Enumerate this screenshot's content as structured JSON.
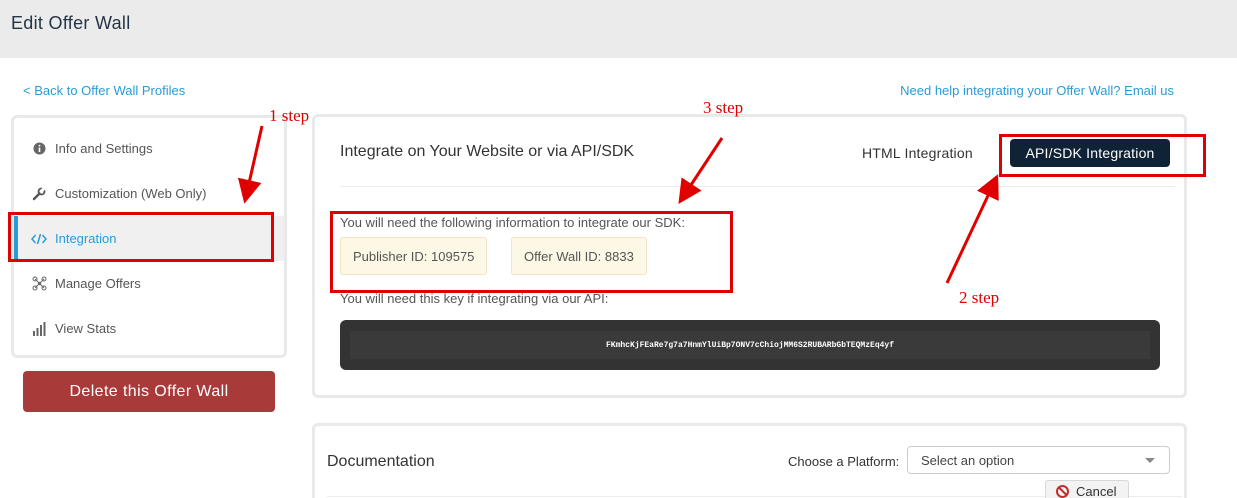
{
  "header": {
    "title": "Edit Offer Wall"
  },
  "links": {
    "back": "< Back to Offer Wall Profiles",
    "help": "Need help integrating your Offer Wall? Email us"
  },
  "sidebar": {
    "items": [
      {
        "label": "Info and Settings",
        "icon": "info-icon",
        "active": false
      },
      {
        "label": "Customization (Web Only)",
        "icon": "wrench-icon",
        "active": false
      },
      {
        "label": "Integration",
        "icon": "code-icon",
        "active": true
      },
      {
        "label": "Manage Offers",
        "icon": "network-icon",
        "active": false
      },
      {
        "label": "View Stats",
        "icon": "bar-chart-icon",
        "active": false
      }
    ],
    "delete_label": "Delete this Offer Wall"
  },
  "integration": {
    "title": "Integrate on Your Website or via API/SDK",
    "tabs": {
      "html": "HTML Integration",
      "api": "API/SDK Integration"
    },
    "sdk_text": "You will need the following information to integrate our SDK:",
    "publisher_id": "Publisher ID: 109575",
    "offer_wall_id": "Offer Wall ID: 8833",
    "api_text": "You will need this key if integrating via our API:",
    "api_key": "FKmhcKjFEaRe7g7a7HnmYlUiBp7ONV7cChiojMM6S2RUBARbGbTEQMzEq4yf"
  },
  "documentation": {
    "title": "Documentation",
    "platform_label": "Choose a Platform:",
    "platform_placeholder": "Select an option",
    "cancel_label": "Cancel"
  },
  "annotations": {
    "step1": "1 step",
    "step2": "2 step",
    "step3": "3 step"
  },
  "colors": {
    "accent": "#2b9bd8",
    "dark_button": "#0f2236",
    "delete_button": "#a83a3a",
    "annotation_red": "#e00000",
    "badge_bg": "#fdf7e6"
  }
}
